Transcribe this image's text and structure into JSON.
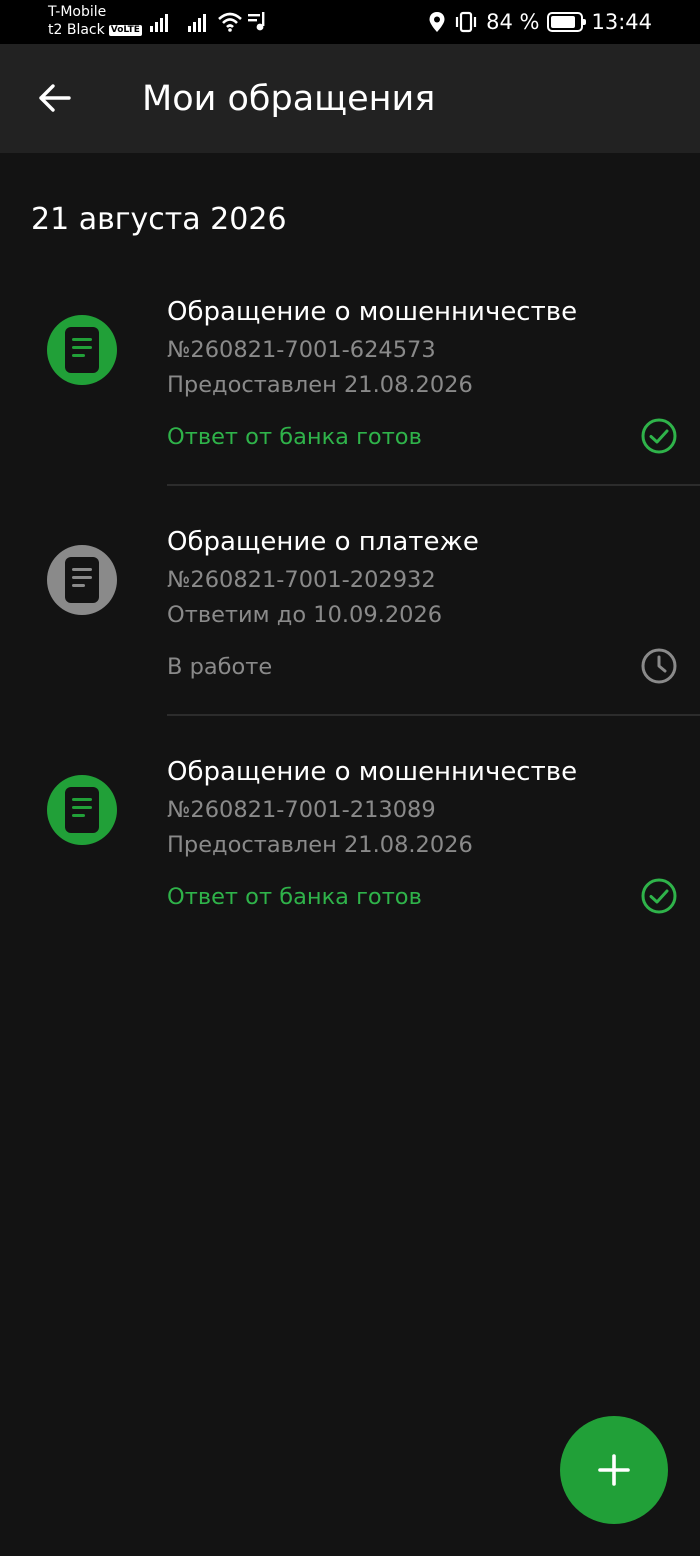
{
  "status_bar": {
    "carrier_line1": "T-Mobile",
    "carrier_line2": "t2 Black",
    "volte": "VoLTE",
    "battery_percent": "84 %",
    "battery_level": 0.84,
    "time": "13:44"
  },
  "header": {
    "title": "Мои обращения",
    "back_icon": "arrow-left-icon"
  },
  "date_group": "21 августа 2026",
  "tickets": [
    {
      "title": "Обращение о мошенничестве",
      "number": "№260821-7001-624573",
      "detail": "Предоставлен 21.08.2026",
      "status": "Ответ от банка готов",
      "state": "done",
      "icon": "document-icon",
      "status_icon": "check-circle-icon"
    },
    {
      "title": "Обращение о платеже",
      "number": "№260821-7001-202932",
      "detail": "Ответим до 10.09.2026",
      "status": "В работе",
      "state": "pending",
      "icon": "document-icon",
      "status_icon": "clock-icon"
    },
    {
      "title": "Обращение о мошенничестве",
      "number": "№260821-7001-213089",
      "detail": "Предоставлен 21.08.2026",
      "status": "Ответ от банка готов",
      "state": "done",
      "icon": "document-icon",
      "status_icon": "check-circle-icon"
    }
  ],
  "fab": {
    "icon": "plus-icon"
  },
  "colors": {
    "accent_green": "#21a038",
    "status_green": "#2fb34a",
    "pending_grey": "#8a8a8a",
    "background": "#131313",
    "app_bar": "#222222"
  }
}
